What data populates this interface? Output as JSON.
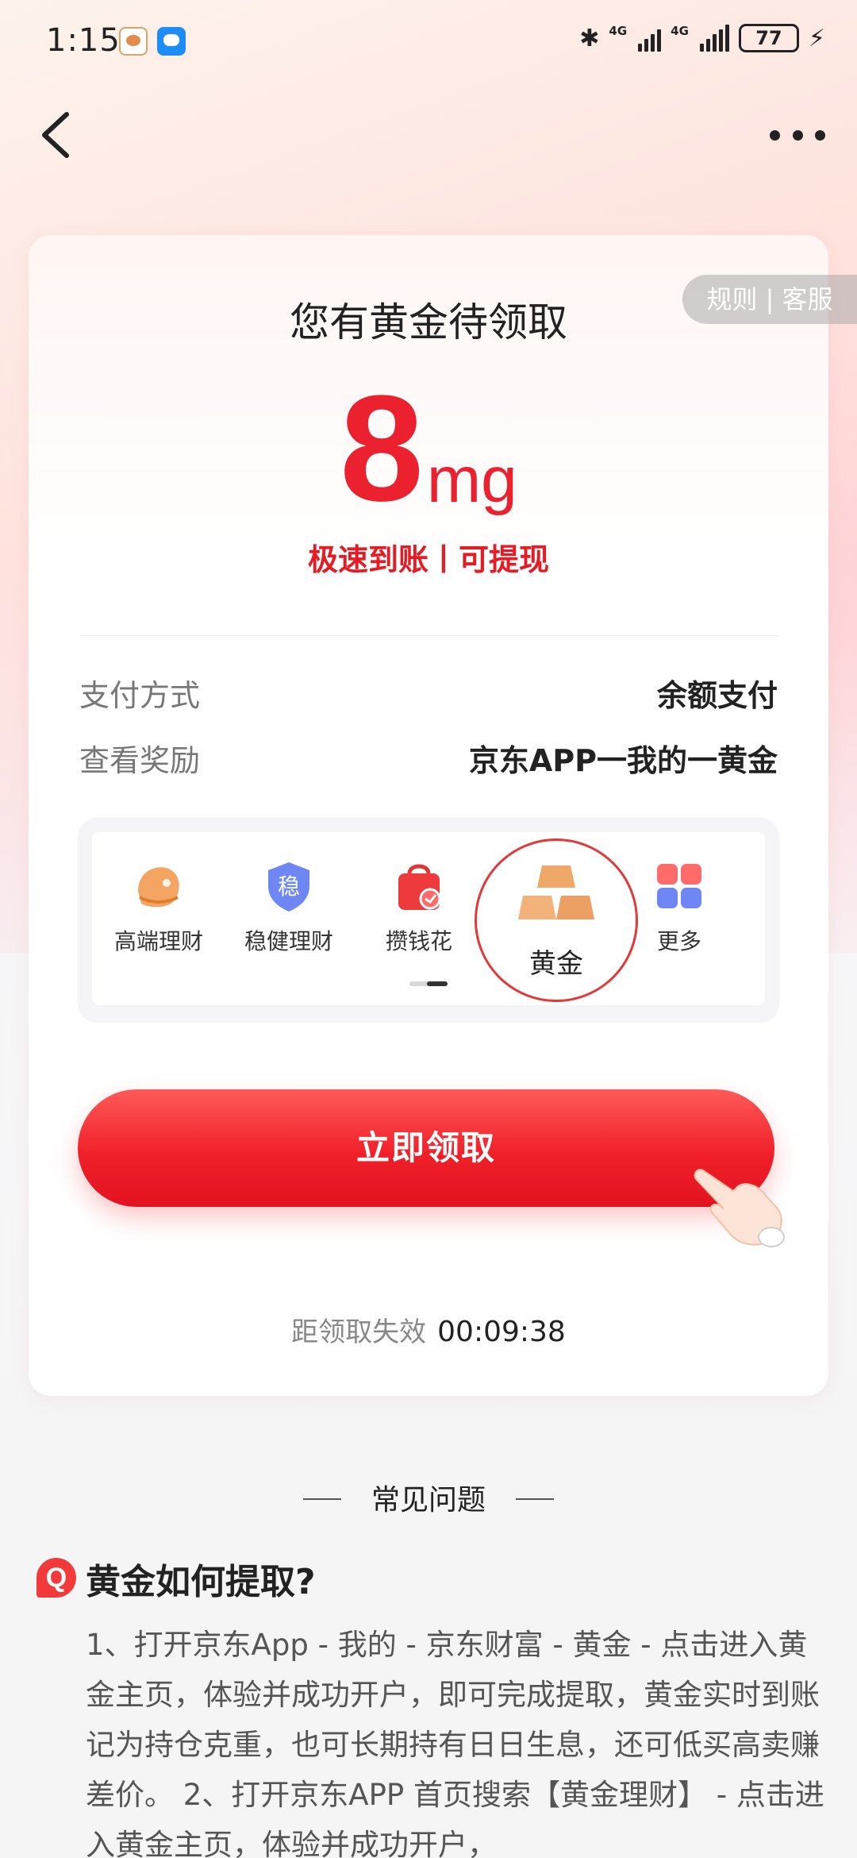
{
  "status_bar": {
    "time": "1:15",
    "network_1": "4G",
    "network_2": "4G",
    "battery": "77"
  },
  "header": {
    "back_icon": "chevron-left-icon",
    "more_icon": "more-dots-icon"
  },
  "card": {
    "rules_link": "规则 | 客服",
    "title": "您有黄金待领取",
    "amount": "8",
    "unit": "mg",
    "tagline": "极速到账丨可提现",
    "payment_label": "支付方式",
    "payment_value": "余额支付",
    "reward_label": "查看奖励",
    "reward_value": "京东APP一我的一黄金",
    "claim_button": "立即领取",
    "countdown_label": "距领取失效",
    "countdown_time": "00:09:38"
  },
  "products": [
    {
      "label": "高端理财",
      "icon": "premium-wealth-icon"
    },
    {
      "label": "稳健理财",
      "icon": "steady-shield-icon",
      "icon_text": "稳"
    },
    {
      "label": "攒钱花",
      "icon": "savings-bag-icon"
    },
    {
      "label": "黄金",
      "icon": "gold-bars-icon"
    },
    {
      "label": "更多",
      "icon": "more-grid-icon"
    }
  ],
  "faq": {
    "header": "常见问题",
    "question": "黄金如何提取?",
    "answer": "1、打开京东App - 我的 - 京东财富 - 黄金 - 点击进入黄金主页，体验并成功开户，即可完成提取，黄金实时到账记为持仓克重，也可长期持有日日生息，还可低买高卖赚差价。 2、打开京东APP 首页搜索【黄金理财】 - 点击进入黄金主页，体验并成功开户，"
  },
  "colors": {
    "brand_red": "#ec2130",
    "button_red": "#f0202a",
    "gold": "#f0a868"
  }
}
